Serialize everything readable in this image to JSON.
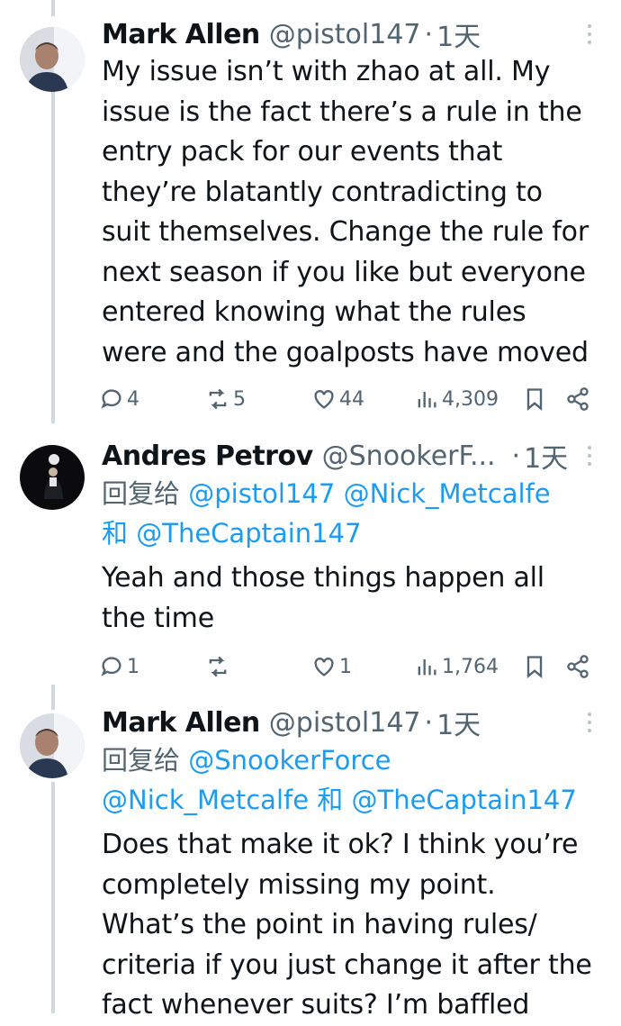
{
  "tweets": [
    {
      "name": "Mark Allen",
      "handle": "@pistol147",
      "separator": "·",
      "time": "1天",
      "reply_prefix": "",
      "reply_mentions": [],
      "text": "My issue isn’t with zhao at all. My\nissue is the fact there’s a rule in the\nentry pack for our events that\nthey’re blatantly contradicting to\nsuit themselves. Change the rule for\nnext season if you like but everyone\nentered knowing what the rules\nwere and the goalposts have moved",
      "replies": "4",
      "retweets": "5",
      "likes": "44",
      "views": "4,309"
    },
    {
      "name": "Andres Petrov",
      "handle": "@SnookerF...",
      "separator": "·",
      "time": "1天",
      "reply_prefix": "回复给",
      "reply_line1_mentions": [
        "@pistol147",
        "@Nick_Metcalfe"
      ],
      "reply_line2_and": "和",
      "reply_line2_mention": "@TheCaptain147",
      "text": "Yeah and those things happen all\nthe time",
      "replies": "1",
      "retweets": "",
      "likes": "1",
      "views": "1,764"
    },
    {
      "name": "Mark Allen",
      "handle": "@pistol147",
      "separator": "·",
      "time": "1天",
      "reply_prefix": "回复给",
      "reply_line1_mentions": [
        "@SnookerForce"
      ],
      "reply_line2_mention_a": "@Nick_Metcalfe",
      "reply_line2_and": "和",
      "reply_line2_mention_b": "@TheCaptain147",
      "text": "Does that make it ok? I think you’re\ncompletely missing my point.\nWhat’s the point in having rules/\ncriteria if you just change it after the\nfact whenever suits? I’m baffled"
    }
  ],
  "icons": {
    "reply": "reply-icon",
    "retweet": "retweet-icon",
    "like": "heart-icon",
    "views": "views-icon",
    "bookmark": "bookmark-icon",
    "share": "share-icon",
    "more": "more-icon"
  },
  "colors": {
    "text": "#0f1419",
    "secondary": "#536471",
    "link": "#1d9bf0",
    "thread_line": "#cfd9de"
  }
}
